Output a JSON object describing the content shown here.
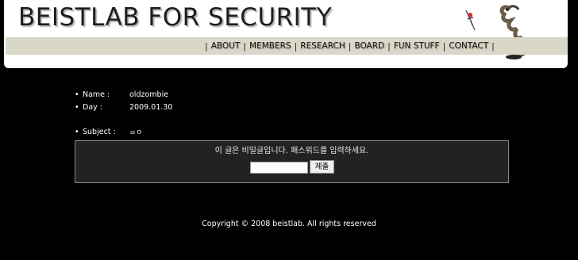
{
  "header": {
    "site_title": "BEISTLAB FOR SECURITY",
    "nav": [
      "ABOUT",
      "MEMBERS",
      "RESEARCH",
      "BOARD",
      "FUN STUFF",
      "CONTACT"
    ],
    "separator": "|"
  },
  "post": {
    "bullet": "•",
    "name_label": "Name :",
    "name_value": "oldzombie",
    "day_label": "Day :",
    "day_value": "2009.01.30",
    "subject_label": "Subject :",
    "subject_value": "=ㅇ"
  },
  "password_form": {
    "message": "이 글은 비밀글입니다. 패스워드를 입력하세요.",
    "input_value": "",
    "submit_label": "제출"
  },
  "footer": {
    "copyright": "Copyright © 2008 beistlab. All rights reserved"
  },
  "colors": {
    "background": "#000000",
    "header_background": "#ffffff",
    "nav_bar": "#d9d7c8",
    "form_box": "#222222"
  }
}
